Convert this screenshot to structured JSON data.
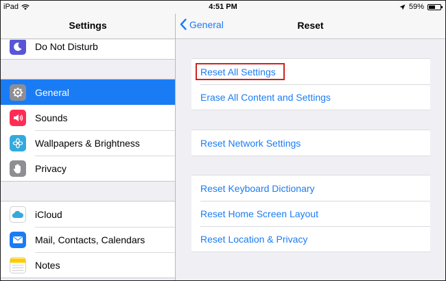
{
  "status_bar": {
    "device": "iPad",
    "time": "4:51 PM",
    "battery": "59%",
    "battery_level": 0.59
  },
  "sidebar": {
    "title": "Settings",
    "groups": [
      [
        {
          "label": "Do Not Disturb",
          "icon": "moon-icon",
          "color": "#5856d6"
        }
      ],
      [
        {
          "label": "General",
          "icon": "gear-icon",
          "color": "#8e8e93",
          "selected": true
        },
        {
          "label": "Sounds",
          "icon": "speaker-icon",
          "color": "#ff2d55"
        },
        {
          "label": "Wallpapers & Brightness",
          "icon": "flower-icon",
          "color": "#34aadc"
        },
        {
          "label": "Privacy",
          "icon": "hand-icon",
          "color": "#8e8e93"
        }
      ],
      [
        {
          "label": "iCloud",
          "icon": "cloud-icon",
          "color": "#34aadc"
        },
        {
          "label": "Mail, Contacts, Calendars",
          "icon": "mail-icon",
          "color": "#1a7cf5"
        },
        {
          "label": "Notes",
          "icon": "notes-icon",
          "color": "#ffcc00"
        }
      ]
    ]
  },
  "detail": {
    "back_label": "General",
    "title": "Reset",
    "groups": [
      [
        "Reset All Settings",
        "Erase All Content and Settings"
      ],
      [
        "Reset Network Settings"
      ],
      [
        "Reset Keyboard Dictionary",
        "Reset Home Screen Layout",
        "Reset Location & Privacy"
      ]
    ]
  },
  "colors": {
    "accent": "#1a7cf5",
    "highlight": "#d21f1f"
  }
}
